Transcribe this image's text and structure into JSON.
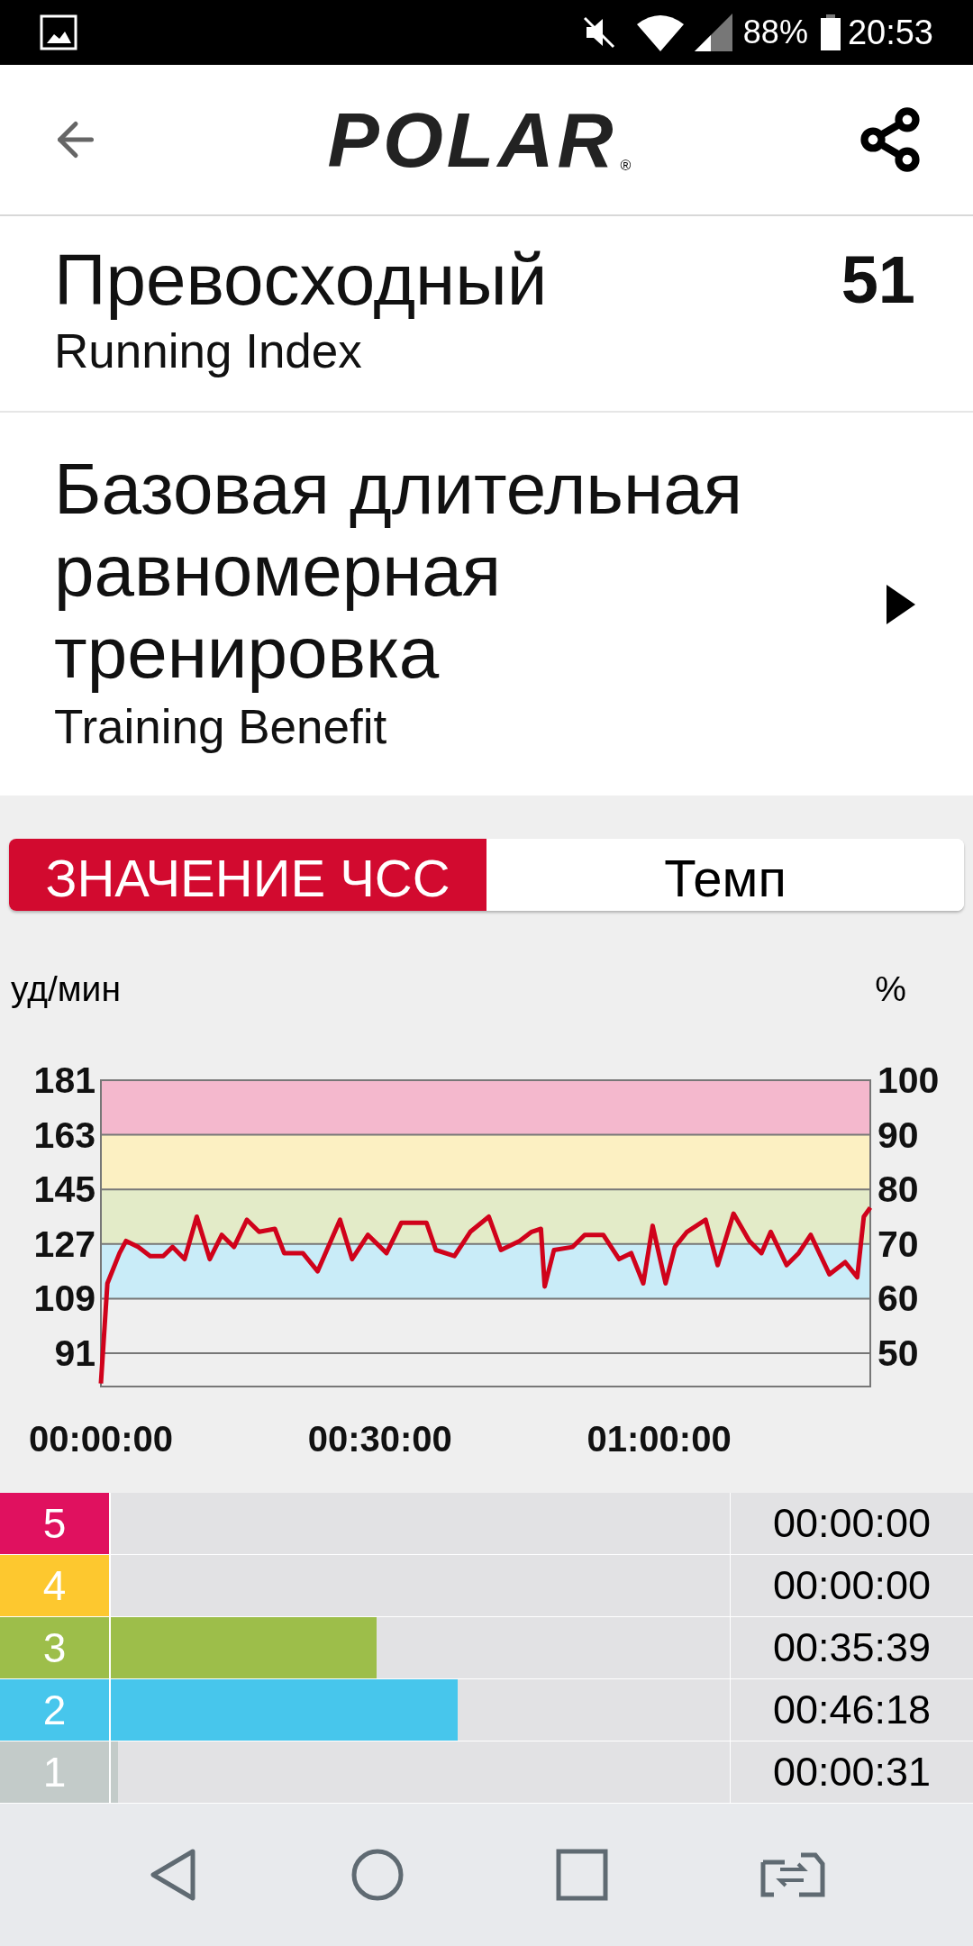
{
  "status_bar": {
    "battery": "88%",
    "time": "20:53"
  },
  "header": {
    "logo": "POLAR",
    "logo_mark": "®"
  },
  "running_index": {
    "rating": "Превосходный",
    "label": "Running Index",
    "value": "51"
  },
  "training_benefit": {
    "title": "Базовая длительная равномерная тренировка",
    "label": "Training Benefit"
  },
  "tabs": [
    {
      "label": "ЗНАЧЕНИЕ ЧСС",
      "selected": true
    },
    {
      "label": "Темп",
      "selected": false
    }
  ],
  "chart": {
    "left_unit": "уд/мин",
    "right_unit": "%",
    "right_ticks": [
      "100",
      "90",
      "80",
      "70",
      "60",
      "50"
    ],
    "chart_data": {
      "type": "line",
      "xlim": [
        0,
        82.7
      ],
      "ylim": [
        80,
        181
      ],
      "xticks": [
        {
          "value": 0,
          "label": "00:00:00"
        },
        {
          "value": 30,
          "label": "00:30:00"
        },
        {
          "value": 60,
          "label": "01:00:00"
        }
      ],
      "yticks": [
        91,
        109,
        127,
        145,
        163,
        181
      ],
      "grid": true,
      "bands": [
        {
          "axis": "y",
          "from": 109,
          "to": 127,
          "color": "#c9ecf8"
        },
        {
          "axis": "y",
          "from": 127,
          "to": 145,
          "color": "#e3ebc8"
        },
        {
          "axis": "y",
          "from": 145,
          "to": 163,
          "color": "#fcf0c2"
        },
        {
          "axis": "y",
          "from": 163,
          "to": 181,
          "color": "#f4b8cd"
        }
      ],
      "x": [
        0,
        0.7,
        2,
        2.7,
        4,
        5.3,
        6.7,
        7.7,
        9,
        10.3,
        11.7,
        13,
        14.3,
        15.7,
        17,
        18.7,
        19.7,
        21.7,
        23.3,
        25.7,
        27,
        28.7,
        30.7,
        32.3,
        35,
        36,
        38,
        39.7,
        41.7,
        43,
        45,
        46.3,
        47.3,
        47.7,
        48.7,
        50.7,
        52,
        54,
        55.7,
        57,
        58.3,
        59.3,
        60.7,
        61.7,
        63,
        65,
        66.3,
        68,
        69.7,
        71,
        72,
        73.7,
        75,
        76.3,
        78.3,
        80,
        81.3,
        82,
        82.7
      ],
      "series": [
        {
          "color": "#d0021b",
          "values": [
            81,
            114,
            124,
            128,
            126,
            123,
            123,
            126,
            122,
            136,
            122,
            130,
            126,
            135,
            131,
            132,
            124,
            124,
            118,
            135,
            122,
            130,
            124,
            134,
            134,
            125,
            123,
            131,
            136,
            125,
            128,
            131,
            132,
            113,
            125,
            126,
            130,
            130,
            122,
            124,
            114,
            133,
            114,
            126,
            131,
            135,
            120,
            137,
            128,
            124,
            131,
            120,
            124,
            130,
            117,
            121,
            116,
            136,
            139
          ]
        }
      ]
    }
  },
  "zones": [
    {
      "label": "5",
      "color": "#e0115f",
      "time": "00:00:00"
    },
    {
      "label": "4",
      "color": "#fdc82f",
      "time": "00:00:00"
    },
    {
      "label": "3",
      "color": "#9dbe4a",
      "level": 0.43,
      "time": "00:35:39"
    },
    {
      "label": "2",
      "color": "#47c6ec",
      "level": 0.561,
      "time": "00:46:18"
    },
    {
      "label": "1",
      "color": "#c3cbc9",
      "level": 0.012,
      "time": "00:00:31"
    }
  ]
}
